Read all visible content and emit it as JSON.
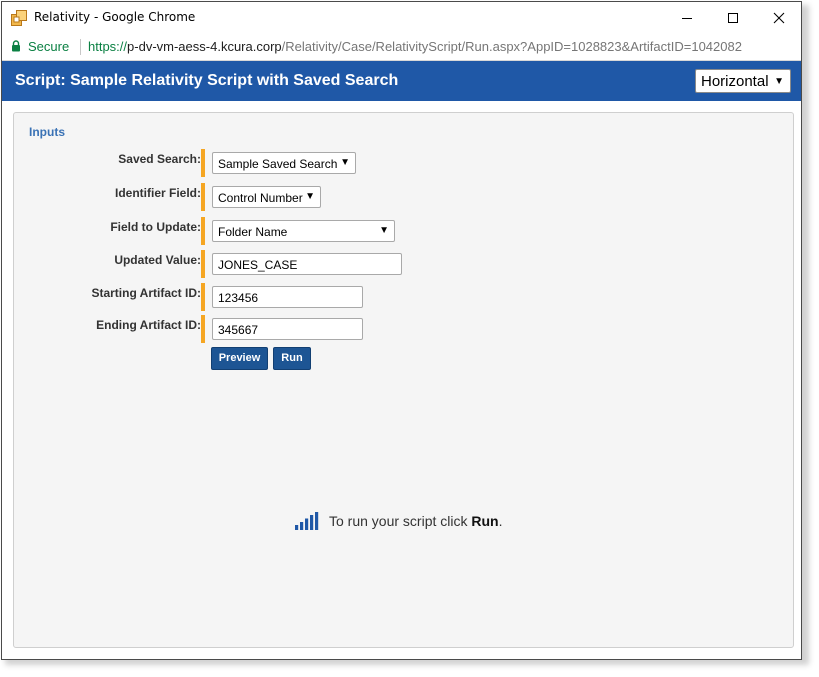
{
  "window": {
    "title": "Relativity - Google Chrome",
    "controls": {
      "minimize": "minimize-icon",
      "maximize": "maximize-icon",
      "close": "close-icon"
    }
  },
  "addressbar": {
    "secure_label": "Secure",
    "url_scheme": "https://",
    "url_host": "p-dv-vm-aess-4.kcura.corp",
    "url_path": "/Relativity/Case/RelativityScript/Run.aspx?AppID=1028823&ArtifactID=1042082"
  },
  "header": {
    "title": "Script: Sample Relativity Script with Saved Search",
    "layout_select": "Horizontal",
    "background": "#1f58a7"
  },
  "inputs": {
    "heading": "Inputs",
    "fields": [
      {
        "label": "Saved Search:",
        "type": "select",
        "value": "Sample Saved Search"
      },
      {
        "label": "Identifier Field:",
        "type": "select",
        "value": "Control Number"
      },
      {
        "label": "Field to Update:",
        "type": "select",
        "value": "Folder Name"
      },
      {
        "label": "Updated Value:",
        "type": "text",
        "value": "JONES_CASE"
      },
      {
        "label": "Starting Artifact ID:",
        "type": "text",
        "value": "123456"
      },
      {
        "label": "Ending Artifact ID:",
        "type": "text",
        "value": "345667"
      }
    ],
    "required_marker_color": "#f5a623"
  },
  "actions": {
    "preview": "Preview",
    "run": "Run",
    "button_color": "#1d5594"
  },
  "hint": {
    "prefix": "To run your script click ",
    "bold": "Run",
    "suffix": "."
  }
}
